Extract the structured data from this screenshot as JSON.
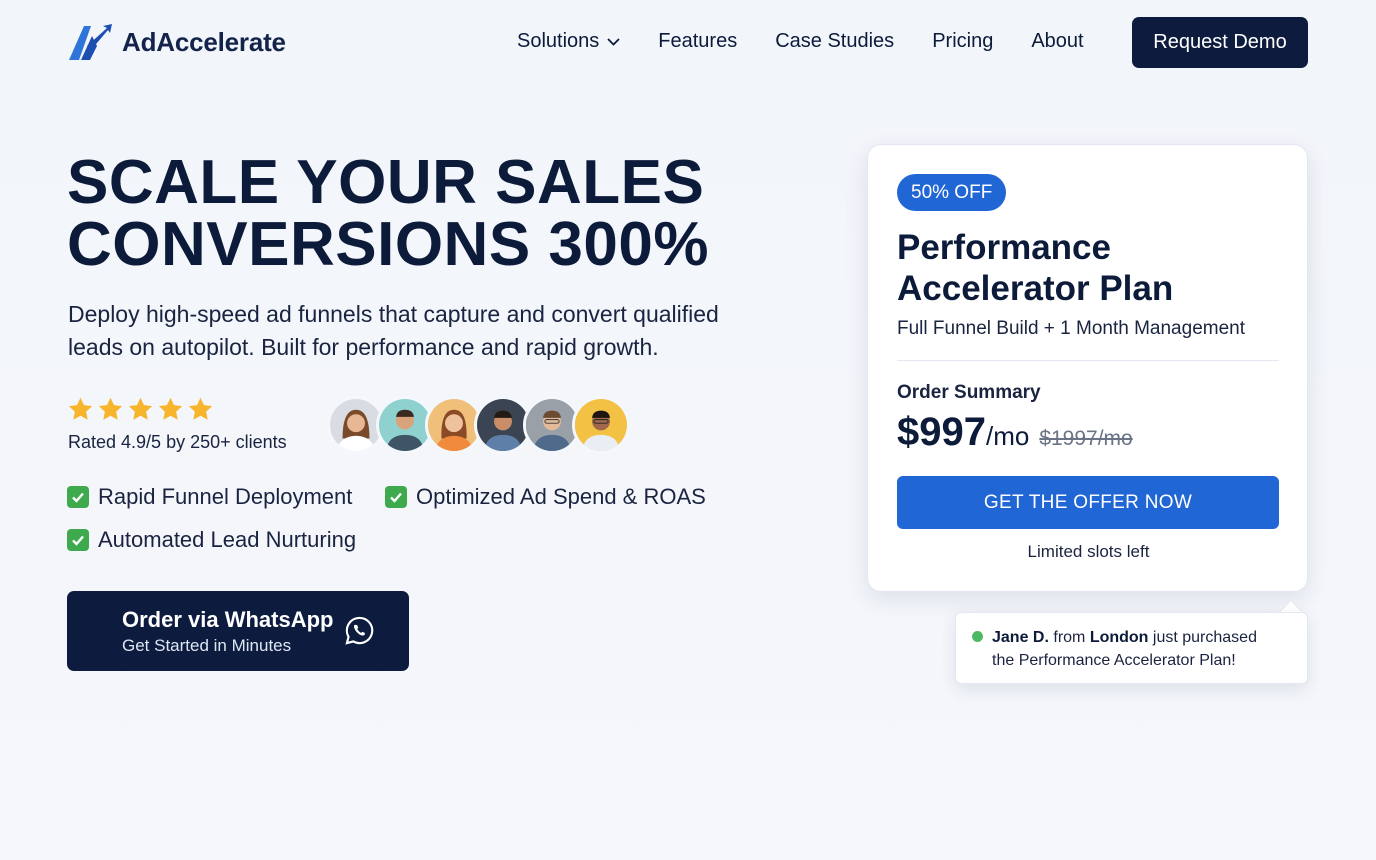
{
  "brand": {
    "name": "AdAccelerate"
  },
  "nav": {
    "items": [
      "Solutions",
      "Features",
      "Case Studies",
      "Pricing",
      "About"
    ],
    "cta": "Request Demo"
  },
  "hero": {
    "headline_line1": "SCALE YOUR SALES",
    "headline_line2": "CONVERSIONS 300%",
    "subcopy": "Deploy high-speed ad funnels that capture and convert qualified leads on autopilot. Built for performance and rapid growth.",
    "rating_stars": 5,
    "rating_text": "Rated 4.9/5 by 250+ clients",
    "bullets": [
      "Rapid Funnel Deployment",
      "Optimized Ad Spend & ROAS",
      "Automated Lead Nurturing"
    ],
    "whatsapp": {
      "title": "Order via WhatsApp",
      "subtitle": "Get Started in Minutes"
    }
  },
  "offer": {
    "badge": "50% OFF",
    "title_line1": "Performance",
    "title_line2": "Accelerator Plan",
    "subtitle": "Full Funnel Build + 1 Month Management",
    "order_label": "Order Summary",
    "price": "$997",
    "price_unit": "/mo",
    "old_price": "$1997/mo",
    "cta": "GET THE OFFER NOW",
    "note": "Limited slots left"
  },
  "toast": {
    "name": "Jane D.",
    "from": " from ",
    "city": "London",
    "line1_rest": " just purchased",
    "line2": "the Performance Accelerator Plan!"
  },
  "colors": {
    "navy": "#0d1c3e",
    "accent": "#2066d4",
    "star": "#f6b52c",
    "check": "#3ea94d",
    "online": "#4fb865"
  }
}
